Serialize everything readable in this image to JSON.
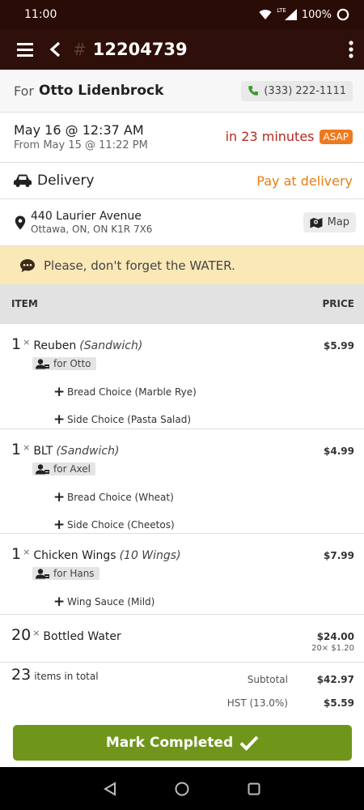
{
  "status_bar": {
    "time": "11:00",
    "battery": "100%",
    "network": "LTE"
  },
  "app_bar": {
    "hash": "#",
    "order_number": "12204739"
  },
  "customer": {
    "for_label": "For",
    "name": "Otto Lidenbrock",
    "phone": "(333) 222-1111"
  },
  "timing": {
    "date": "May 16 @ 12:37 AM",
    "from": "From May 15 @ 11:22 PM",
    "eta": "in 23 minutes",
    "badge": "ASAP"
  },
  "delivery": {
    "label": "Delivery",
    "payment": "Pay at delivery"
  },
  "address": {
    "line1": "440 Laurier Avenue",
    "line2": "Ottawa, ON, ON K1R 7X6",
    "map_label": "Map"
  },
  "note": {
    "text": "Please, don't forget the WATER."
  },
  "table": {
    "item_header": "ITEM",
    "price_header": "PRICE"
  },
  "items": [
    {
      "qty": "1",
      "times": "×",
      "name": "Reuben",
      "category": "(Sandwich)",
      "price": "$5.99",
      "for": "for Otto",
      "modifiers": [
        "Bread Choice (Marble Rye)",
        "Side Choice (Pasta Salad)"
      ]
    },
    {
      "qty": "1",
      "times": "×",
      "name": "BLT",
      "category": "(Sandwich)",
      "price": "$4.99",
      "for": "for Axel",
      "modifiers": [
        "Bread Choice (Wheat)",
        "Side Choice (Cheetos)"
      ]
    },
    {
      "qty": "1",
      "times": "×",
      "name": "Chicken Wings",
      "category": "(10 Wings)",
      "price": "$7.99",
      "for": "for Hans",
      "modifiers": [
        "Wing Sauce (Mild)"
      ]
    },
    {
      "qty": "20",
      "times": "×",
      "name": "Bottled Water",
      "price": "$24.00",
      "unit_price": "20× $1.20"
    }
  ],
  "totals": {
    "count": "23",
    "count_label": "items in total",
    "subtotal_label": "Subtotal",
    "subtotal": "$42.97",
    "tax_label": "HST (13.0%)",
    "tax": "$5.59"
  },
  "action": {
    "complete_label": "Mark Completed"
  },
  "colors": {
    "header": "#2f0f09",
    "accent_red": "#b52a1f",
    "accent_orange": "#e47e16",
    "note_bg": "#fae8b7",
    "complete_button": "#6f961a"
  },
  "icons": [
    "menu-icon",
    "back-icon",
    "more-icon",
    "phone-icon",
    "car-icon",
    "location-pin-icon",
    "map-icon",
    "chat-icon",
    "person-icon",
    "plus-icon",
    "check-icon"
  ]
}
